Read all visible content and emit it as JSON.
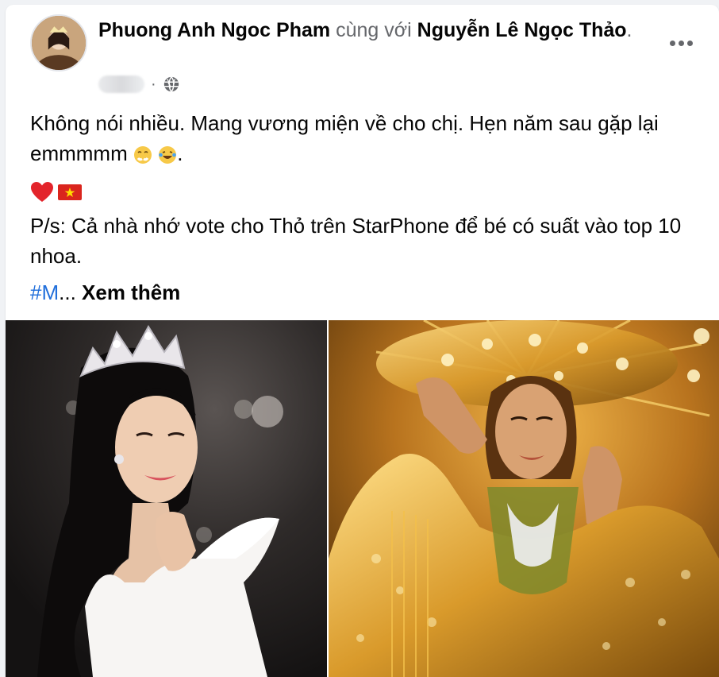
{
  "post": {
    "author": "Phuong Anh Ngoc Pham",
    "with_text": "cùng với",
    "tagged_name": "Nguyễn Lê Ngọc Thảo",
    "tagged_suffix": ".",
    "meta_separator": "·",
    "privacy_icon": "globe-icon",
    "menu_icon": "more-horizontal-icon",
    "text_line1": "Không nói nhiều. Mang vương miện về cho chị. Hẹn năm sau gặp lại emmmmm",
    "text_line1_suffix": ".",
    "emoji_line": [
      "heart-emoji",
      "vietnam-flag-emoji"
    ],
    "text_ps": "P/s: Cả nhà nhớ vote cho Thỏ trên StarPhone để bé có suất vào top 10 nhoa.",
    "hashtag": "#M",
    "ellipsis": "...",
    "see_more": "Xem thêm"
  },
  "photos": [
    {
      "name": "photo-left",
      "subject": "woman in white dress with crown"
    },
    {
      "name": "photo-right",
      "subject": "woman in golden costume with golden headdress"
    }
  ],
  "colors": {
    "link": "#216fdb",
    "secondary_text": "#65676b",
    "page_bg": "#f0f2f5"
  }
}
